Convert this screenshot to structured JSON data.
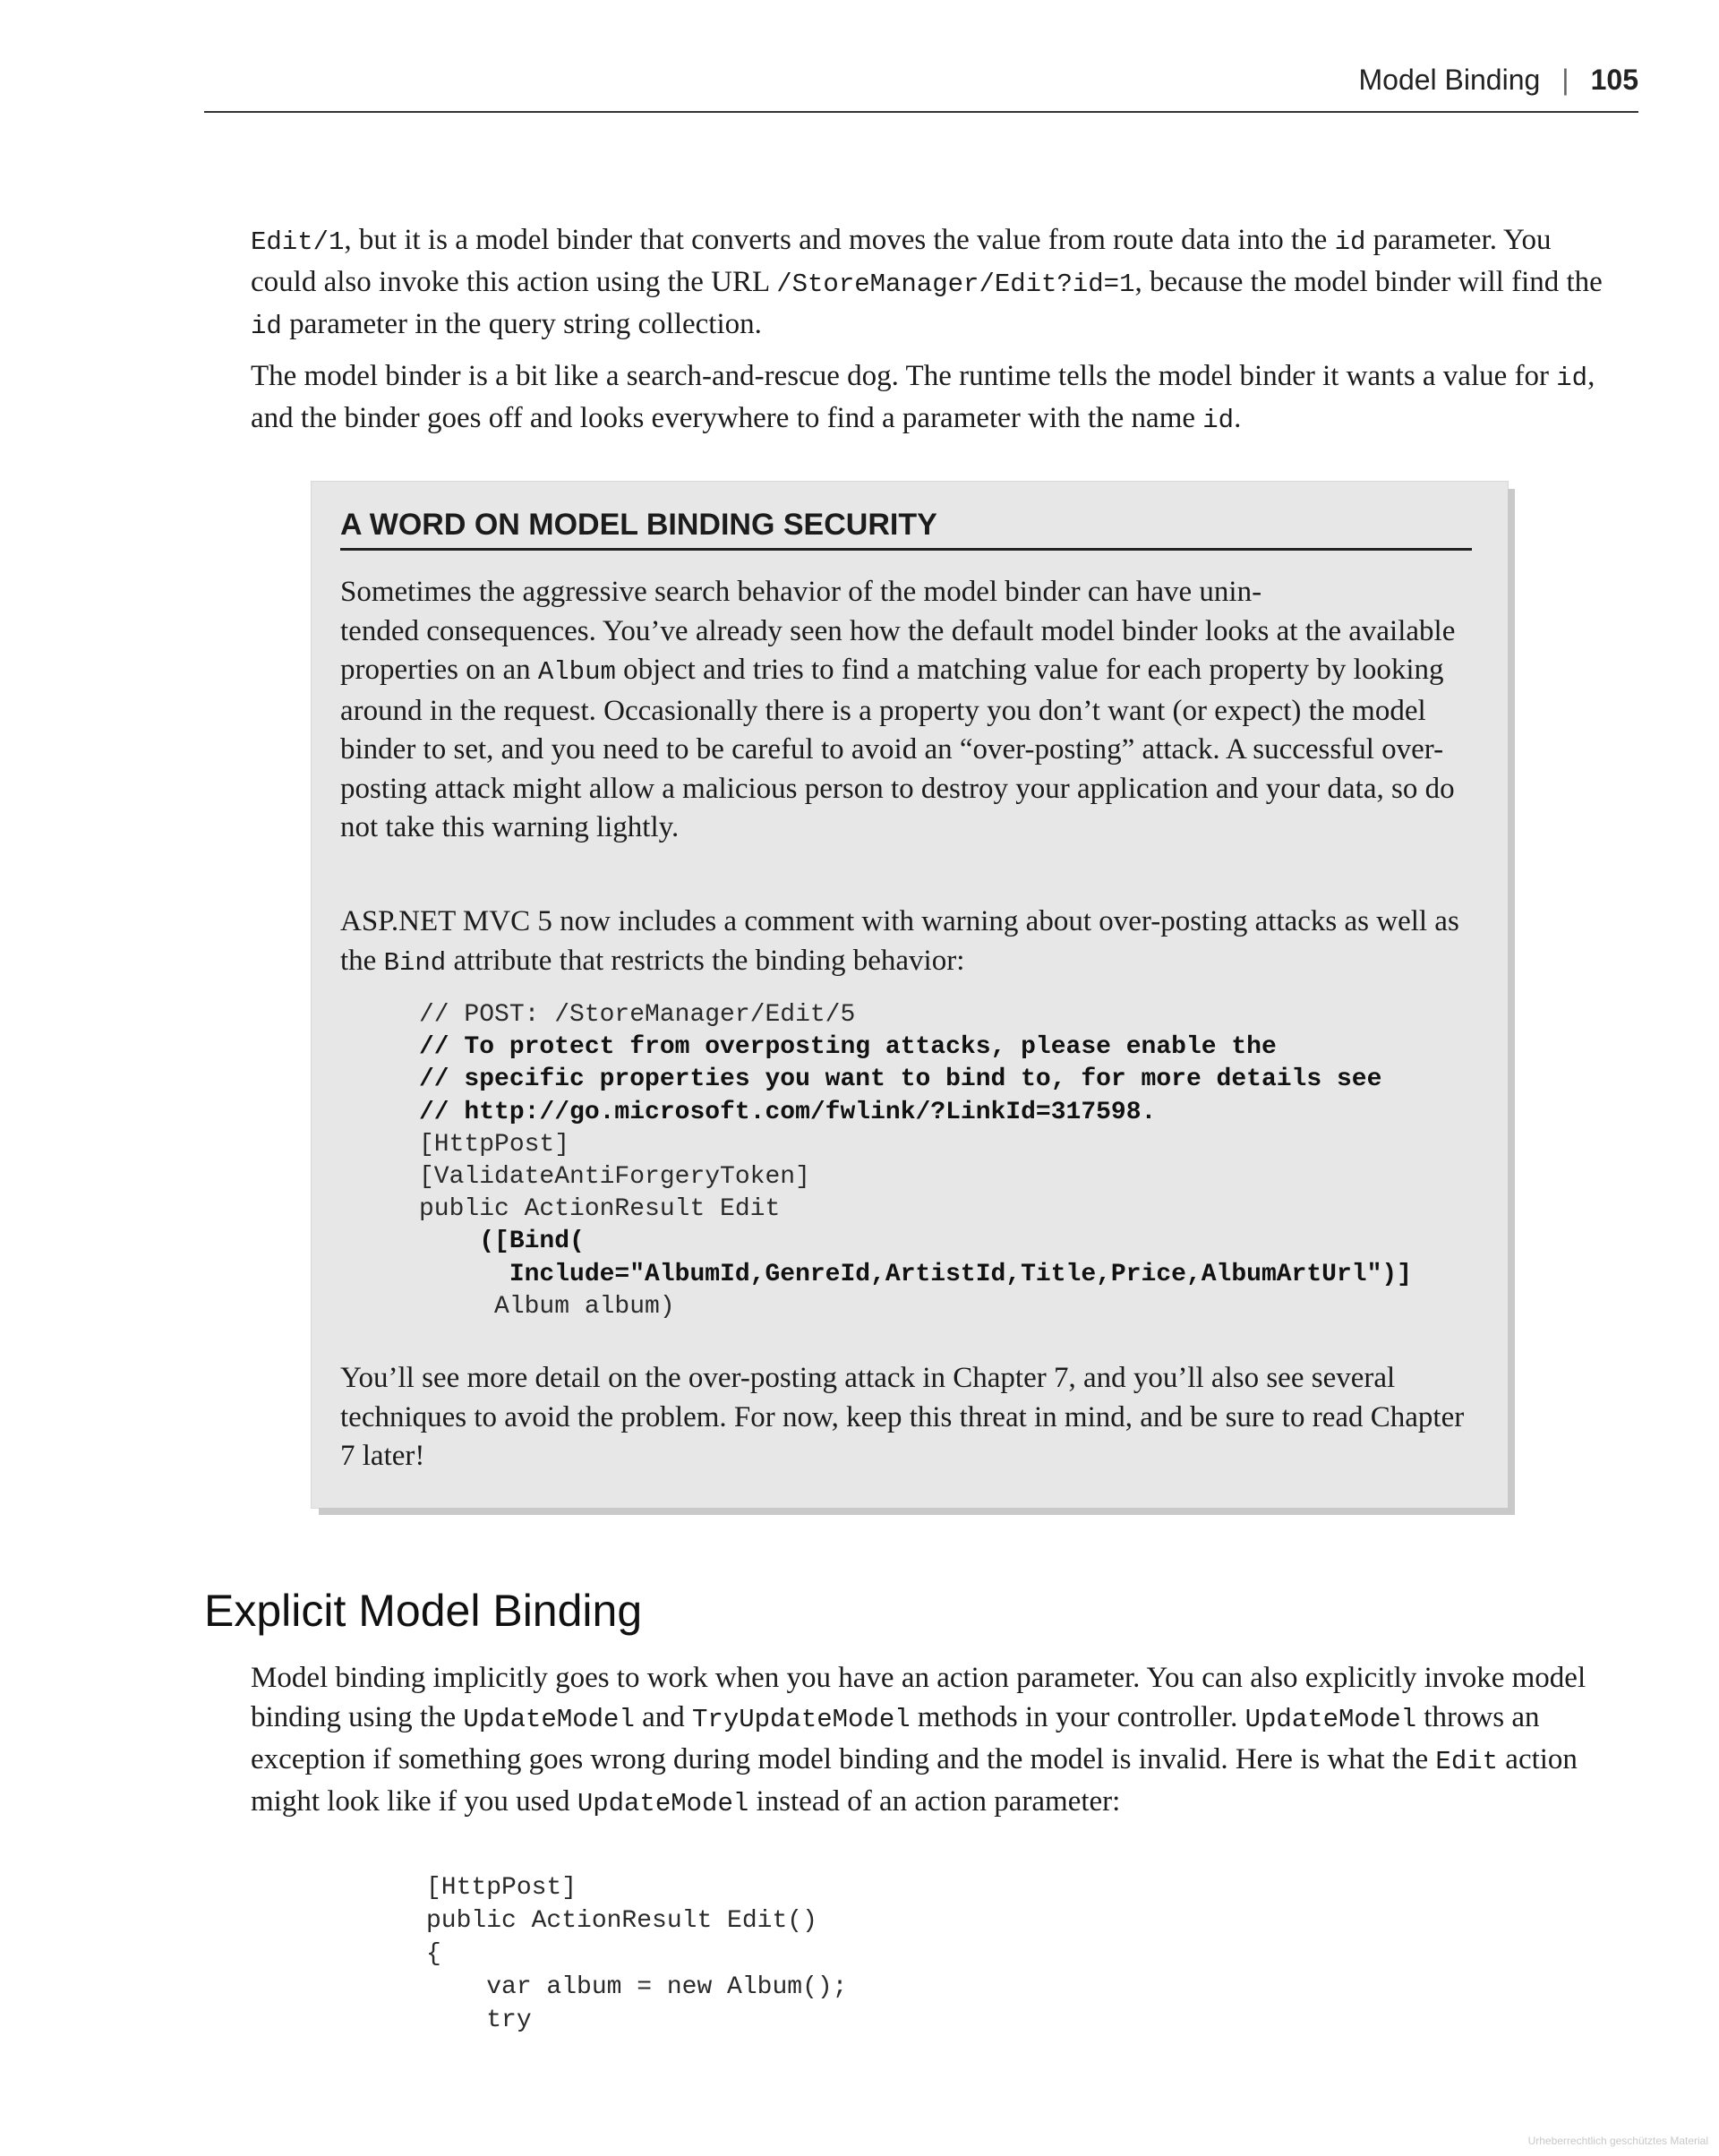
{
  "header": {
    "running_title": "Model Binding",
    "separator": "|",
    "page_number": "105"
  },
  "intro": {
    "p1": [
      {
        "t": "code",
        "v": "Edit/1"
      },
      {
        "t": "text",
        "v": ", but it is a model binder that converts and moves the value from route data into the "
      },
      {
        "t": "code",
        "v": "id"
      },
      {
        "t": "text",
        "v": " parameter. You could also invoke this action using the URL "
      },
      {
        "t": "code",
        "v": "/StoreManager/Edit?id=1"
      },
      {
        "t": "text",
        "v": ", because the model binder will find the "
      },
      {
        "t": "code",
        "v": "id"
      },
      {
        "t": "text",
        "v": " parameter in the query string collection."
      }
    ],
    "p2": [
      {
        "t": "text",
        "v": "The model binder is a bit like a search-and-rescue dog. The runtime tells the model binder it wants a value for "
      },
      {
        "t": "code",
        "v": "id"
      },
      {
        "t": "text",
        "v": ", and the binder goes off and looks everywhere to find a parameter with the name "
      },
      {
        "t": "code",
        "v": "id"
      },
      {
        "t": "text",
        "v": "."
      }
    ]
  },
  "sidebar": {
    "title": "A WORD ON MODEL BINDING SECURITY",
    "p1": [
      {
        "t": "text",
        "v": "Sometimes the aggressive search behavior of the model binder can have unin-"
      },
      {
        "t": "br"
      },
      {
        "t": "text",
        "v": "tended consequences. You’ve already seen how the default model binder looks at the available properties on an "
      },
      {
        "t": "code",
        "v": "Album"
      },
      {
        "t": "text",
        "v": " object and tries to find a matching value for each property by looking around in the request. Occasionally there is a property you don’t want (or expect) the model binder to set, and you need to be careful to avoid an “over-posting” attack. A successful over-posting attack might allow a malicious person to destroy your application and your data, so do not take this warning lightly."
      }
    ],
    "p2": [
      {
        "t": "text",
        "v": "ASP.NET MVC 5 now includes a comment with warning about over-posting attacks as well as the "
      },
      {
        "t": "code",
        "v": "Bind"
      },
      {
        "t": "text",
        "v": " attribute that restricts the binding behavior:"
      }
    ],
    "code": [
      {
        "text": "// POST: /StoreManager/Edit/5",
        "bold": false
      },
      {
        "text": "// To protect from overposting attacks, please enable the",
        "bold": true
      },
      {
        "text": "// specific properties you want to bind to, for more details see",
        "bold": true
      },
      {
        "text": "// http://go.microsoft.com/fwlink/?LinkId=317598.",
        "bold": true
      },
      {
        "text": "[HttpPost]",
        "bold": false
      },
      {
        "text": "[ValidateAntiForgeryToken]",
        "bold": false
      },
      {
        "text": "public ActionResult Edit",
        "bold": false
      },
      {
        "text": "    ([Bind(",
        "bold": true
      },
      {
        "text": "      Include=\"AlbumId,GenreId,ArtistId,Title,Price,AlbumArtUrl\")]",
        "bold": true
      },
      {
        "text": "     Album album)",
        "bold": false
      }
    ],
    "p3": [
      {
        "t": "text",
        "v": "You’ll see more detail on the over-posting attack in Chapter 7, and you’ll also see several techniques to avoid the problem. For now, keep this threat in mind, and be sure to read Chapter 7 later!"
      }
    ]
  },
  "section": {
    "heading": "Explicit Model Binding",
    "p1": [
      {
        "t": "text",
        "v": "Model binding implicitly goes to work when you have an action parameter. You can also explicitly invoke model binding using the "
      },
      {
        "t": "code",
        "v": "UpdateModel"
      },
      {
        "t": "text",
        "v": " and "
      },
      {
        "t": "code",
        "v": "TryUpdateModel"
      },
      {
        "t": "text",
        "v": " methods in your controller. "
      },
      {
        "t": "code",
        "v": "UpdateModel"
      },
      {
        "t": "text",
        "v": " throws an exception if something goes wrong during model binding and the model is invalid. Here is what the "
      },
      {
        "t": "code",
        "v": "Edit"
      },
      {
        "t": "text",
        "v": " action might look like if you used "
      },
      {
        "t": "code",
        "v": "UpdateModel"
      },
      {
        "t": "text",
        "v": " instead of an action parameter:"
      }
    ],
    "code": [
      {
        "text": "[HttpPost]",
        "bold": false
      },
      {
        "text": "public ActionResult Edit()",
        "bold": false
      },
      {
        "text": "{",
        "bold": false
      },
      {
        "text": "    var album = new Album();",
        "bold": false
      },
      {
        "text": "    try",
        "bold": false
      }
    ]
  },
  "watermark": "Urheberrechtlich geschütztes Material"
}
